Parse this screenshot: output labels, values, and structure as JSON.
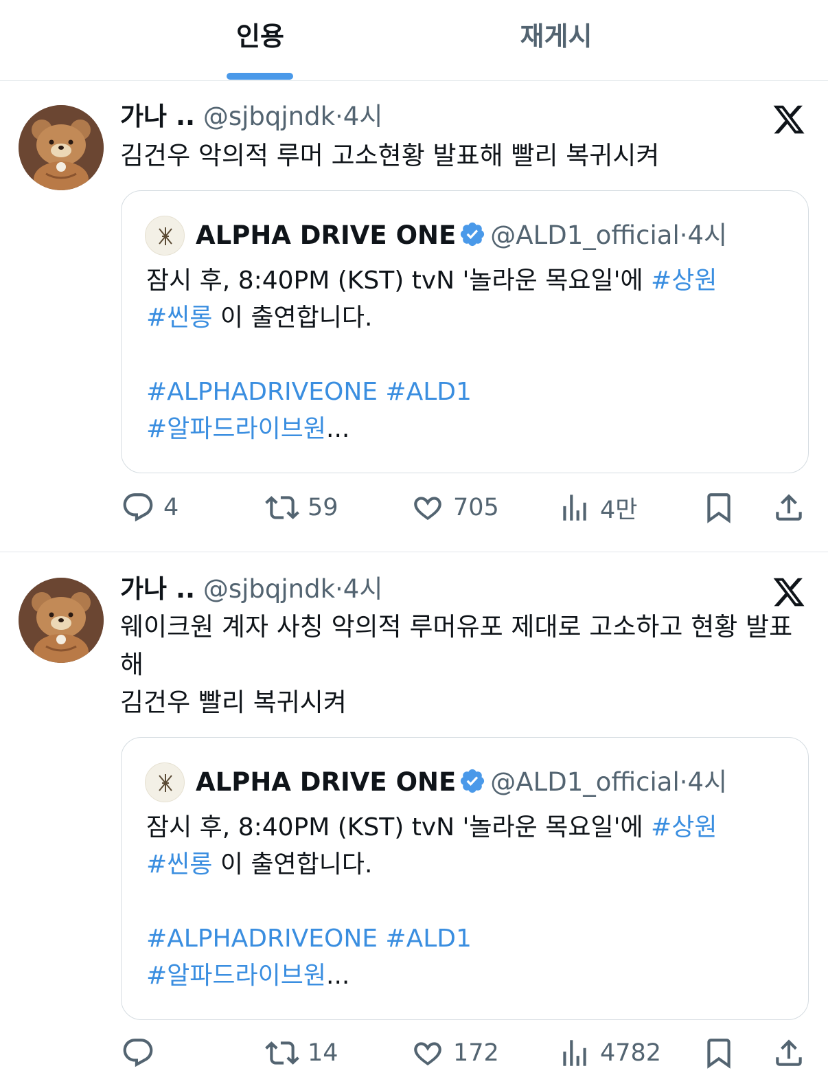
{
  "tabs": [
    {
      "label": "인용",
      "active": true
    },
    {
      "label": "재게시",
      "active": false
    }
  ],
  "colors": {
    "accent": "#4a99e9",
    "link": "#3a8ee0",
    "muted": "#536471",
    "verified": "#4a99e9"
  },
  "tweets": [
    {
      "name": "가나 ..",
      "handle": "@sjbqjndk",
      "dot": "·",
      "time": "4시",
      "text": "김건우 악의적 루머 고소현황 발표해 빨리 복귀시켜",
      "quote": {
        "name": "ALPHA DRIVE ONE",
        "handle": "@ALD1_official",
        "dot": "·",
        "time": "4시",
        "line1_plain": "잠시 후, 8:40PM (KST) tvN '놀라운 목요일'에 ",
        "line1_tag": "#상원",
        "line2_tag": "#씬롱",
        "line2_plain": " 이 출연합니다.",
        "line4": "#ALPHADRIVEONE #ALD1",
        "line5_tag": "#알파드라이브원",
        "line5_plain": "..."
      },
      "stats": {
        "replies": "4",
        "reposts": "59",
        "likes": "705",
        "views": "4만"
      }
    },
    {
      "name": "가나 ..",
      "handle": "@sjbqjndk",
      "dot": "·",
      "time": "4시",
      "text": "웨이크원 계자 사칭 악의적 루머유포 제대로 고소하고 현황 발표해\n김건우 빨리 복귀시켜",
      "quote": {
        "name": "ALPHA DRIVE ONE",
        "handle": "@ALD1_official",
        "dot": "·",
        "time": "4시",
        "line1_plain": "잠시 후, 8:40PM (KST) tvN '놀라운 목요일'에 ",
        "line1_tag": "#상원",
        "line2_tag": "#씬롱",
        "line2_plain": " 이 출연합니다.",
        "line4": "#ALPHADRIVEONE #ALD1",
        "line5_tag": "#알파드라이브원",
        "line5_plain": "..."
      },
      "stats": {
        "replies": "",
        "reposts": "14",
        "likes": "172",
        "views": "4782"
      }
    }
  ]
}
